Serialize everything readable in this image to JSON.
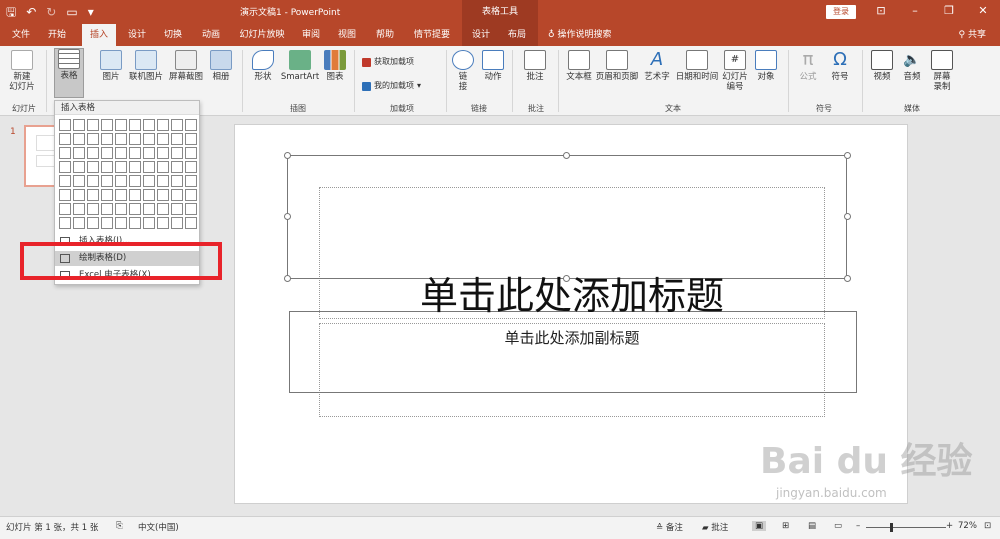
{
  "titlebar": {
    "doc_title": "演示文稿1 - PowerPoint",
    "context_group": "表格工具",
    "login": "登录",
    "accent": "#b7472a"
  },
  "tabs": [
    {
      "label": "文件"
    },
    {
      "label": "开始"
    },
    {
      "label": "插入"
    },
    {
      "label": "设计"
    },
    {
      "label": "切换"
    },
    {
      "label": "动画"
    },
    {
      "label": "幻灯片放映"
    },
    {
      "label": "审阅"
    },
    {
      "label": "视图"
    },
    {
      "label": "帮助"
    },
    {
      "label": "情节提要"
    },
    {
      "label": "设计"
    },
    {
      "label": "布局"
    }
  ],
  "search_label": "操作说明搜索",
  "share_label": "共享",
  "ribbon": {
    "new_slide": "新建\n幻灯片",
    "table": "表格",
    "picture": "图片",
    "online_picture": "联机图片",
    "screenshot": "屏幕截图",
    "album": "相册",
    "shapes": "形状",
    "smartart": "SmartArt",
    "chart": "图表",
    "get_addins": "获取加载项",
    "my_addins": "我的加载项",
    "link": "链\n接",
    "action": "动作",
    "comment": "批注",
    "textbox": "文本框",
    "header_footer": "页眉和页脚",
    "wordart": "艺术字",
    "datetime": "日期和时间",
    "slide_number": "幻灯片\n编号",
    "object": "对象",
    "equation": "公式",
    "symbol": "符号",
    "video": "视频",
    "audio": "音频",
    "screen_recording": "屏幕\n录制",
    "groups": {
      "slides": "幻灯片",
      "illustrations": "插图",
      "addins": "加载项",
      "links": "链接",
      "comments": "批注",
      "text": "文本",
      "symbols": "符号",
      "media": "媒体"
    }
  },
  "dropdown": {
    "header": "插入表格",
    "grid_cols": 10,
    "grid_rows": 8,
    "items": [
      "插入表格(I)...",
      "绘制表格(D)",
      "Excel 电子表格(X)"
    ]
  },
  "slides_panel": {
    "number": "1"
  },
  "slide": {
    "title": "单击此处添加标题",
    "subtitle": "单击此处添加副标题"
  },
  "status": {
    "slide_info": "幻灯片 第 1 张，共 1 张",
    "language": "中文(中国)",
    "notes": "备注",
    "comments": "批注",
    "zoom": "72%"
  },
  "watermark": {
    "text": "Bai du 经验",
    "sub": "jingyan.baidu.com"
  }
}
